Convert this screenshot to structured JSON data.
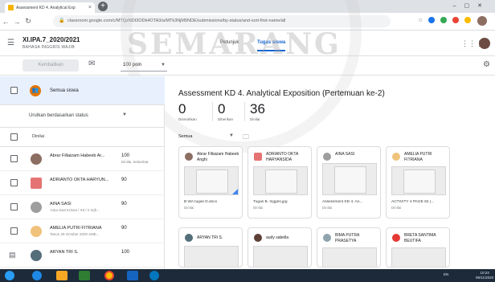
{
  "browser": {
    "tab_title": "Assessment KD 4. Analytical Exp",
    "url": "classroom.google.com/c/MTQzNDI3ODk4OTA3/a/MTk3NjM5NDE/submissions/by-status/and-sort-first-name/all"
  },
  "header": {
    "class_name": "XI.IPA.7_2020/2021",
    "class_subtitle": "BAHASA INGGRIS WAJIB",
    "nav_tabs": [
      {
        "label": "Petunjuk"
      },
      {
        "label": "Tugas siswa"
      }
    ]
  },
  "toolbar": {
    "return_label": "Kembalikan",
    "points_value": "100 poin"
  },
  "watermark": "SEMARANG",
  "student_list": {
    "all_label": "Semua siswa",
    "sort_label": "Urutkan berdasarkan status",
    "section_label": "Dinilai",
    "students": [
      {
        "initial": "A",
        "name": "Abrar Fillaizam Habeeb Ar...",
        "note": "",
        "score": "100",
        "status": "Dinilai, terlambat",
        "color": "#8d6e63"
      },
      {
        "initial": "A",
        "name": "ADRIANTO OKTA HARYUN...",
        "note": "",
        "score": "90",
        "status": "",
        "color": "#e57373"
      },
      {
        "initial": "A",
        "name": "AINA SASI",
        "note": "'Aina Sasi Krisna / XII / ri m(b...",
        "score": "90",
        "status": "",
        "color": "#9e9e9e"
      },
      {
        "initial": "A",
        "name": "AMELIA PUTRI FITRIANA",
        "note": "Tanon 29 October 2020 AME...",
        "score": "90",
        "status": "",
        "color": "#f0c27b"
      },
      {
        "initial": "A",
        "name": "ARYAN TRI S.",
        "note": "",
        "score": "100",
        "status": "",
        "color": "#546e7a"
      }
    ]
  },
  "main": {
    "title": "Assessment KD 4. Analytical Exposition (Pertemuan ke-2)",
    "stats": [
      {
        "num": "0",
        "label": "Diserahkan"
      },
      {
        "num": "0",
        "label": "Diberikan"
      },
      {
        "num": "36",
        "label": "Dinilai"
      }
    ],
    "filter_label": "Semua",
    "cards_row1": [
      {
        "name": "Abrar Fillaizam Habeeb Anghi",
        "file": "B WA tugas D.docx",
        "status": "Dinilai",
        "color": "#8d6e63"
      },
      {
        "name": "ADRIANTO OKTA HARYANSIDA",
        "file": "Tugas B. Inggris.jpg",
        "status": "Dinilai",
        "color": "#e57373"
      },
      {
        "name": "AINA SASI",
        "file": "Assessment KD 4. An...",
        "status": "Dinilai",
        "color": "#9e9e9e"
      },
      {
        "name": "AMELIA PUTRI FITRIANA",
        "file": "ACTIVITY 4 PAGE 62 (...",
        "status": "Dinilai",
        "color": "#f0c27b"
      }
    ],
    "cards_row2": [
      {
        "name": "ARYAN TRI S.",
        "color": "#546e7a"
      },
      {
        "name": "audy sabella",
        "color": "#5d4037"
      },
      {
        "name": "BIMA PUTRA PRASETYA",
        "color": "#90a4ae"
      },
      {
        "name": "BRETA SANTIMA BEUTIFA",
        "color": "#e53935"
      }
    ]
  },
  "taskbar": {
    "tray": "EN",
    "time": "10:24",
    "date": "06/11/2020"
  }
}
